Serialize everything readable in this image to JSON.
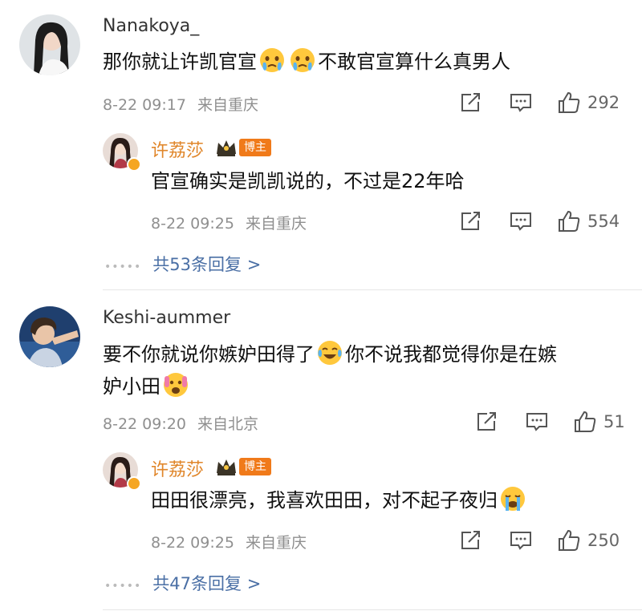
{
  "comments": [
    {
      "username": "Nanakoya_",
      "text_a": "那你就让许凯官宣",
      "text_b": "不敢官宣算什么真男人",
      "emojis": [
        "tearful-emoji",
        "tearful-emoji"
      ],
      "time": "8-22 09:17",
      "location": "来自重庆",
      "likes": "292",
      "reply": {
        "username": "许荔莎",
        "badge": "博主",
        "text": "官宣确实是凯凯说的，不过是22年哈",
        "time": "8-22 09:25",
        "location": "来自重庆",
        "likes": "554"
      },
      "more": "共53条回复 >"
    },
    {
      "username": "Keshi-aummer",
      "text_line1a": "要不你就说你嫉妒田得了",
      "text_line1b": "你不说我都觉得你是在嫉",
      "text_line2": "妒小田",
      "emojis": [
        "laugh-cry-emoji",
        "scream-emoji"
      ],
      "time": "8-22 09:20",
      "location": "来自北京",
      "likes": "51",
      "reply": {
        "username": "许荔莎",
        "badge": "博主",
        "text": "田田很漂亮，我喜欢田田，对不起子夜归",
        "emojis": [
          "crying-emoji"
        ],
        "time": "8-22 09:25",
        "location": "来自重庆",
        "likes": "250"
      },
      "more": "共47条回复 >"
    }
  ],
  "colors": {
    "accent_name": "#e0862a",
    "link": "#4a6fa5",
    "badge": "#f07a1a"
  }
}
